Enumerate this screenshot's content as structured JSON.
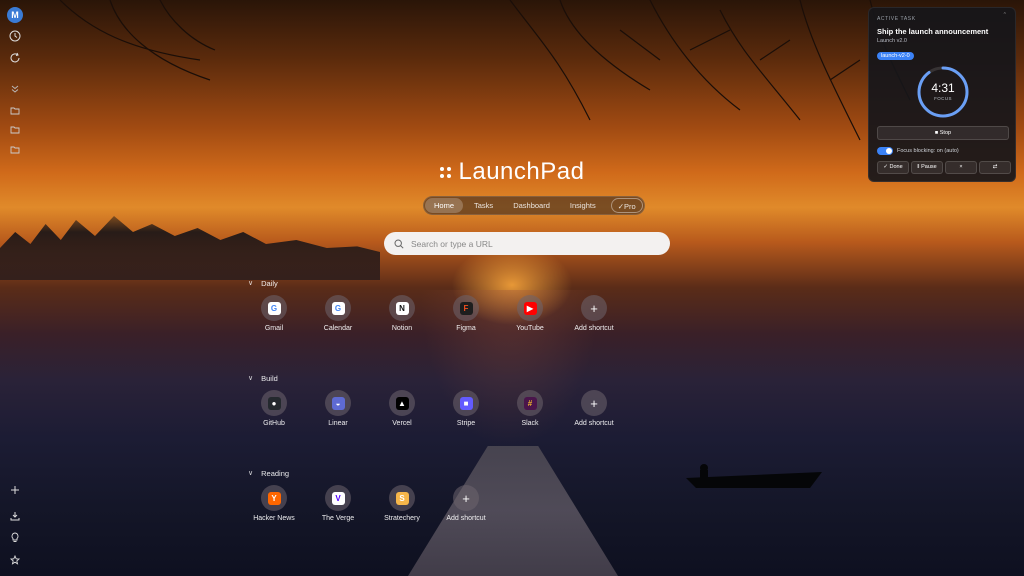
{
  "user": {
    "initial": "M"
  },
  "rail": {
    "top_items": [
      {
        "icon": "clock-icon"
      },
      {
        "icon": "refresh-icon"
      },
      {
        "icon": "collapse-icon"
      },
      {
        "icon": "folder-icon"
      },
      {
        "icon": "folder-icon"
      },
      {
        "icon": "folder-icon"
      }
    ],
    "bottom_items": [
      {
        "icon": "plus-icon"
      },
      {
        "icon": "download-icon"
      },
      {
        "icon": "lightbulb-icon"
      },
      {
        "icon": "star-icon"
      }
    ]
  },
  "brand": {
    "name": "LaunchPad"
  },
  "nav": {
    "tabs": [
      {
        "label": "Home",
        "active": true
      },
      {
        "label": "Tasks"
      },
      {
        "label": "Dashboard"
      },
      {
        "label": "Insights"
      }
    ],
    "pro_label": "✓Pro"
  },
  "search": {
    "placeholder": "Search or type a URL"
  },
  "groups": [
    {
      "title": "Daily",
      "tiles": [
        {
          "label": "Gmail",
          "icon": "G",
          "color": "#ffffff",
          "text_color": "#4285f4"
        },
        {
          "label": "Calendar",
          "icon": "G",
          "color": "#ffffff",
          "text_color": "#4285f4"
        },
        {
          "label": "Notion",
          "icon": "N",
          "color": "#ffffff",
          "text_color": "#111111"
        },
        {
          "label": "Figma",
          "icon": "F",
          "color": "#1e1e1e",
          "text_color": "#f24e1e"
        },
        {
          "label": "YouTube",
          "icon": "▶",
          "color": "#ff0000",
          "text_color": "#ffffff"
        },
        {
          "label": "Add shortcut",
          "add": true
        }
      ]
    },
    {
      "title": "Build",
      "tiles": [
        {
          "label": "GitHub",
          "icon": "●",
          "color": "#24292e",
          "text_color": "#ffffff"
        },
        {
          "label": "Linear",
          "icon": "◒",
          "color": "#5e6ad2",
          "text_color": "#ffffff"
        },
        {
          "label": "Vercel",
          "icon": "▲",
          "color": "#000000",
          "text_color": "#ffffff"
        },
        {
          "label": "Stripe",
          "icon": "■",
          "color": "#635bff",
          "text_color": "#ffffff"
        },
        {
          "label": "Slack",
          "icon": "#",
          "color": "#4a154b",
          "text_color": "#ecb22e"
        },
        {
          "label": "Add shortcut",
          "add": true
        }
      ]
    },
    {
      "title": "Reading",
      "tiles": [
        {
          "label": "Hacker News",
          "icon": "Y",
          "color": "#ff6600",
          "text_color": "#ffffff"
        },
        {
          "label": "The Verge",
          "icon": "V",
          "color": "#ffffff",
          "text_color": "#5200ff"
        },
        {
          "label": "Stratechery",
          "icon": "S",
          "color": "#f6b64a",
          "text_color": "#ffffff"
        },
        {
          "label": "Add shortcut",
          "add": true
        }
      ]
    }
  ],
  "active_task": {
    "kicker": "ACTIVE TASK",
    "title": "Ship the launch announcement",
    "subtitle": "Launch v2.0",
    "tag": "launch-v2-0",
    "timer": "4:31",
    "mode": "FOCUS",
    "progress": 0.9,
    "stop_label": "■ Stop",
    "focus_blocking": "Focus blocking: on (auto)",
    "actions": [
      {
        "label": "✓ Done"
      },
      {
        "label": "‖ Pause"
      },
      {
        "label": "×"
      },
      {
        "label": "⇄"
      }
    ],
    "accent": "#3b82f6"
  }
}
